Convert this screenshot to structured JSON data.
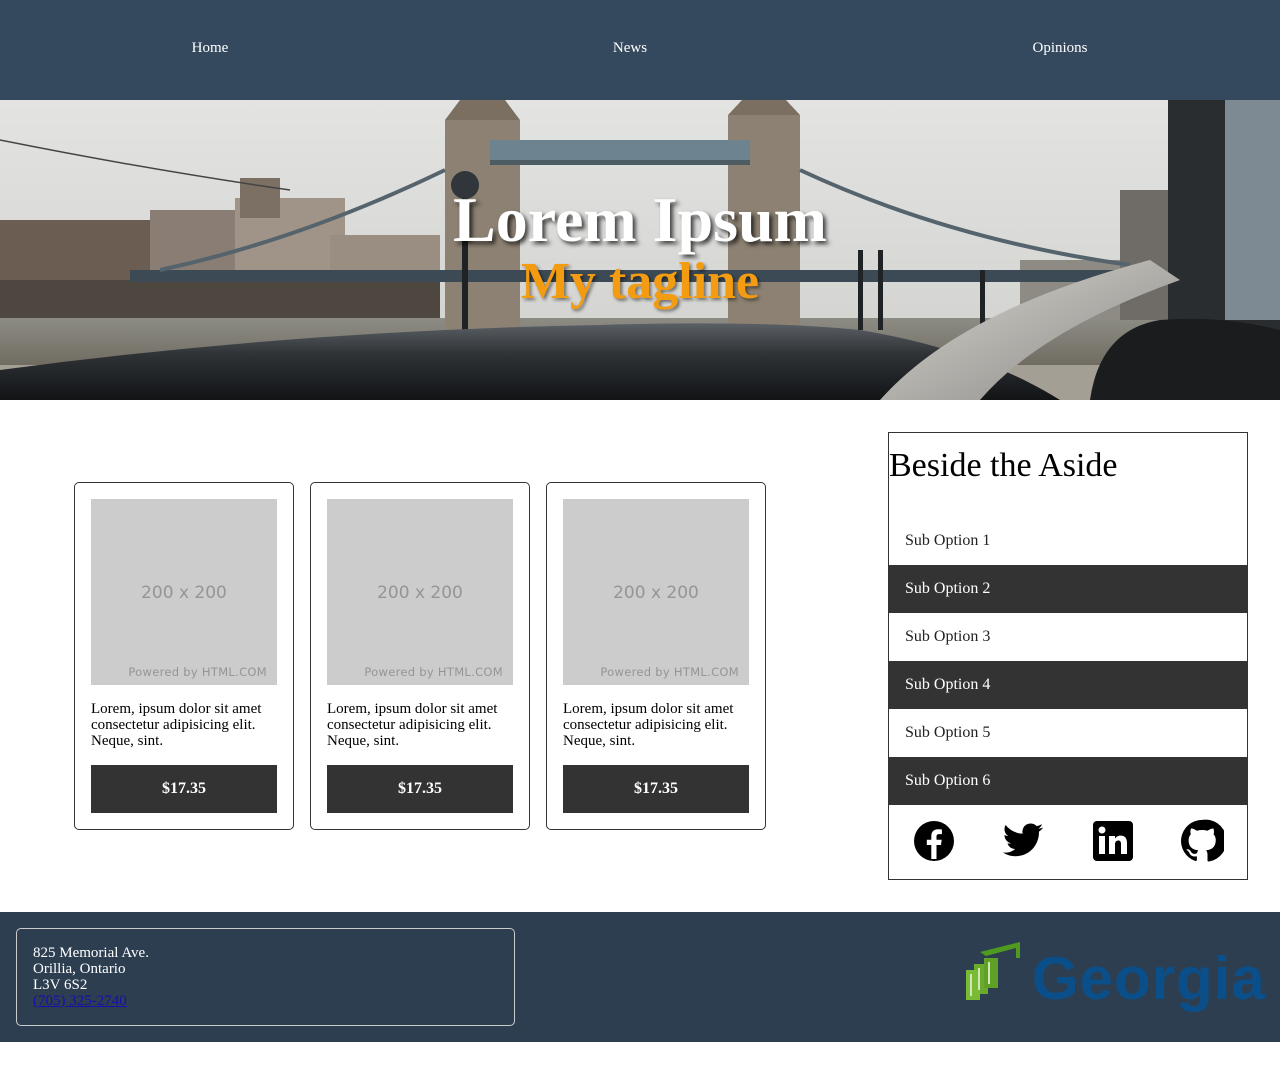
{
  "nav": {
    "items": [
      {
        "label": "Home"
      },
      {
        "label": "News"
      },
      {
        "label": "Opinions"
      }
    ]
  },
  "hero": {
    "title": "Lorem Ipsum",
    "tagline": "My tagline",
    "tagline_color": "#f39c12"
  },
  "products": [
    {
      "image_dim": "200 x 200",
      "image_credit": "Powered by HTML.COM",
      "description": "Lorem, ipsum dolor sit amet consectetur adipisicing elit. Neque, sint.",
      "price": "$17.35"
    },
    {
      "image_dim": "200 x 200",
      "image_credit": "Powered by HTML.COM",
      "description": "Lorem, ipsum dolor sit amet consectetur adipisicing elit. Neque, sint.",
      "price": "$17.35"
    },
    {
      "image_dim": "200 x 200",
      "image_credit": "Powered by HTML.COM",
      "description": "Lorem, ipsum dolor sit amet consectetur adipisicing elit. Neque, sint.",
      "price": "$17.35"
    }
  ],
  "aside": {
    "title": "Beside the Aside",
    "options": [
      {
        "label": "Sub Option 1"
      },
      {
        "label": "Sub Option 2"
      },
      {
        "label": "Sub Option 3"
      },
      {
        "label": "Sub Option 4"
      },
      {
        "label": "Sub Option 5"
      },
      {
        "label": "Sub Option 6"
      }
    ],
    "social_icons": [
      "facebook-icon",
      "twitter-icon",
      "linkedin-icon",
      "github-icon"
    ]
  },
  "footer": {
    "address_line1": "825 Memorial Ave.",
    "address_line2": "Orillia, Ontario",
    "address_line3": "L3V 6S2",
    "phone": "(705) 325-2740",
    "logo_text": "Georgian",
    "logo_color": "#0b4f8a",
    "logo_mark_color": "#6aab2e"
  },
  "colors": {
    "nav_bg": "#34495e",
    "footer_bg": "#2c3e50",
    "button_bg": "#333333",
    "placeholder_bg": "#cccccc"
  }
}
